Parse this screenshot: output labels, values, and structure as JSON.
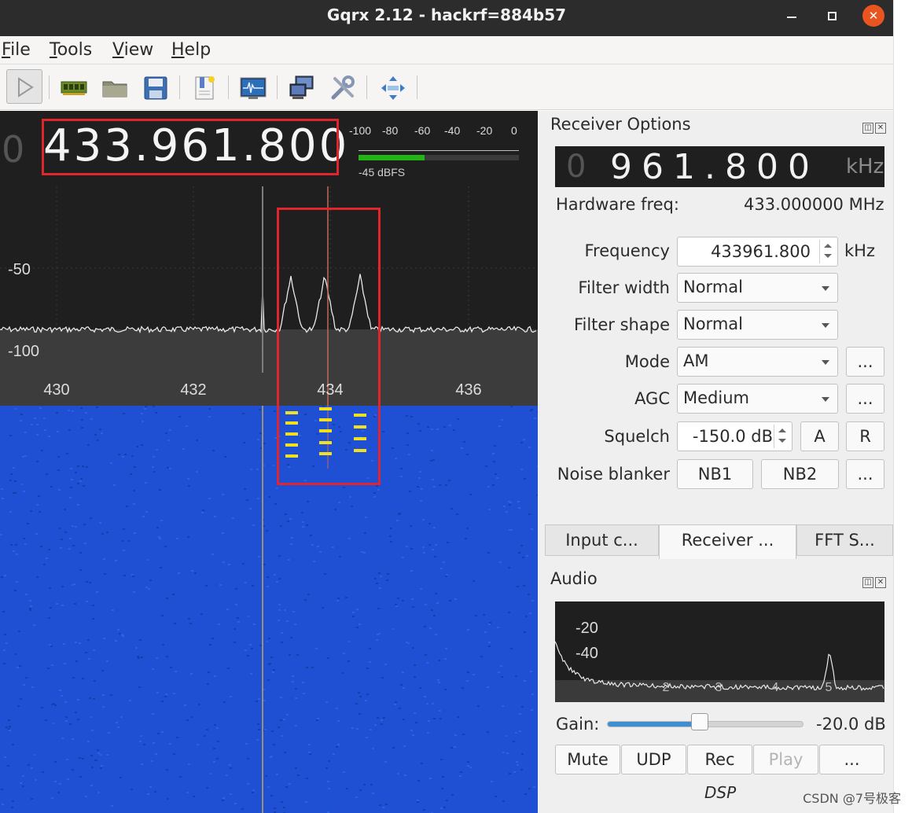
{
  "window": {
    "title": "Gqrx 2.12 - hackrf=884b57"
  },
  "menu": {
    "file": "File",
    "tools": "Tools",
    "view": "View",
    "help": "Help"
  },
  "toolbar": [
    "play-icon",
    "device-icon",
    "open-folder-icon",
    "save-icon",
    "bookmark-icon",
    "fft-settings-icon",
    "network-icon",
    "tools-icon",
    "fullscreen-icon"
  ],
  "frequency": {
    "leading_digit": "0",
    "value": "433.961.800"
  },
  "meter": {
    "scale": [
      "-100",
      "-80",
      "-60",
      "-40",
      "-20",
      "0"
    ],
    "level_dbfs": -45,
    "label": "-45 dBFS"
  },
  "spectrum": {
    "y_labels": [
      "-50",
      "-100"
    ],
    "x_labels": [
      "430",
      "432",
      "434",
      "436"
    ],
    "colors": {
      "background_plot": "#1f1f1f",
      "trace": "#e8e8e8",
      "marker": "#c26a5a",
      "highlight": "#e0262c",
      "waterfall": "#1f4fd2",
      "signal": "#f0e020"
    }
  },
  "receiver": {
    "dock_title": "Receiver Options",
    "khz_display": {
      "leading": "0",
      "value": "961.800",
      "unit": "kHz"
    },
    "hardware_freq_label": "Hardware freq:",
    "hardware_freq_value": "433.000000 MHz",
    "frequency_label": "Frequency",
    "frequency_value": "433961.800",
    "frequency_unit": "kHz",
    "filter_width_label": "Filter width",
    "filter_width_value": "Normal",
    "filter_shape_label": "Filter shape",
    "filter_shape_value": "Normal",
    "mode_label": "Mode",
    "mode_value": "AM",
    "agc_label": "AGC",
    "agc_value": "Medium",
    "squelch_label": "Squelch",
    "squelch_value": "-150.0 dB",
    "squelch_a": "A",
    "squelch_r": "R",
    "noise_blanker_label": "Noise blanker",
    "nb1": "NB1",
    "nb2": "NB2",
    "more": "..."
  },
  "tabs": [
    "Input c...",
    "Receiver ...",
    "FFT S..."
  ],
  "audio": {
    "dock_title": "Audio",
    "fft_y_labels": [
      "-20",
      "-40"
    ],
    "fft_x_labels": [
      "2",
      "3",
      "4",
      "5"
    ],
    "gain_label": "Gain:",
    "gain_value": "-20.0 dB",
    "gain_fraction": 0.47,
    "buttons": {
      "mute": "Mute",
      "udp": "UDP",
      "rec": "Rec",
      "play": "Play",
      "more": "..."
    },
    "dsp_label": "DSP"
  },
  "watermark": "CSDN @7号极客"
}
